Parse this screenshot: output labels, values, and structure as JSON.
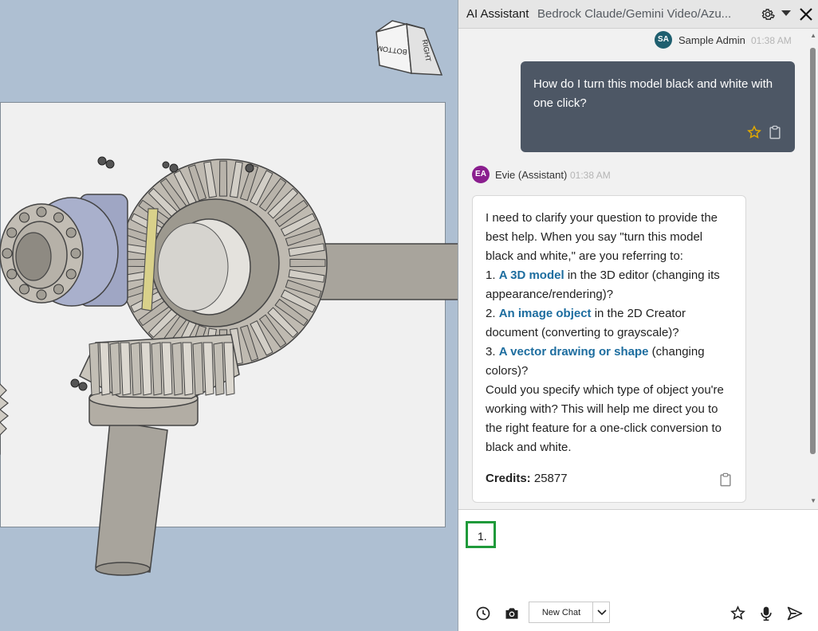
{
  "panel": {
    "title": "AI Assistant",
    "subtitle": "Bedrock Claude/Gemini Video/Azu..."
  },
  "viewcube": {
    "face_bottom": "BOTTOM",
    "face_right": "RIGHT"
  },
  "messages": {
    "user": {
      "avatar": "SA",
      "name": "Sample Admin",
      "time": "01:38 AM",
      "avatar_color": "#1f5f6f",
      "text": "How do I turn this model black and white with one click?"
    },
    "assistant": {
      "avatar": "EA",
      "name": "Evie (Assistant)",
      "time": "01:38 AM",
      "avatar_color": "#8a1e8e",
      "intro": "I need to clarify your question to provide the best help. When you say \"turn this model black and white,\" are you referring to:",
      "options": [
        {
          "num": "1.",
          "link": "A 3D model",
          "rest": " in the 3D editor (changing its appearance/rendering)?"
        },
        {
          "num": "2.",
          "link": "An image object",
          "rest": " in the 2D Creator document (converting to grayscale)?"
        },
        {
          "num": "3.",
          "link": "A vector drawing or shape",
          "rest": " (changing colors)?"
        }
      ],
      "outro": "Could you specify which type of object you're working with? This will help me direct you to the right feature for a one-click conversion to black and white.",
      "credits_label": "Credits:",
      "credits_value": "25877"
    }
  },
  "input": {
    "value": "1."
  },
  "toolbar": {
    "new_chat_label": "New Chat"
  },
  "colors": {
    "accent_link": "#1d6d9f",
    "user_bubble": "#4d5765",
    "input_focus": "#1f9a3a",
    "star": "#e0a800"
  }
}
